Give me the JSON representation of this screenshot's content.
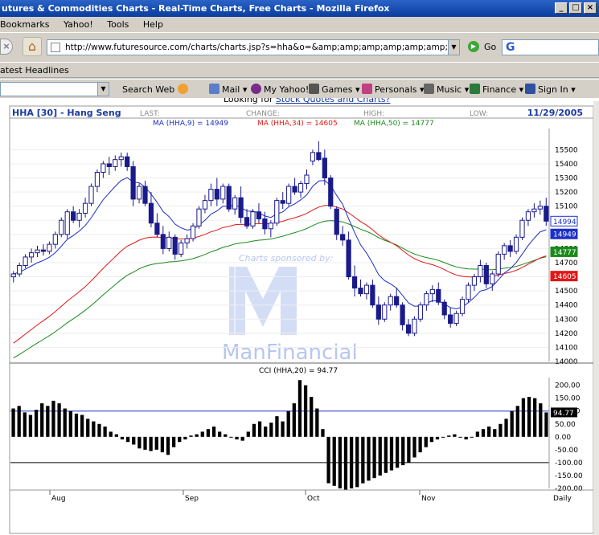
{
  "window": {
    "title": "utures & Commodities Charts - Real-Time Charts, Free Charts - Mozilla Firefox",
    "buttons": [
      "_",
      "□",
      "×"
    ]
  },
  "menu": [
    "Bookmarks",
    "Yahoo!",
    "Tools",
    "Help"
  ],
  "nav": {
    "url": "http://www.futuresource.com/charts/charts.jsp?s=hha&o=&amp;amp;amp;amp;amp;amp;amp;amp;amp;a=D",
    "go_label": "Go"
  },
  "bookmarks": {
    "headlines": "atest Headlines"
  },
  "yahoo_toolbar": {
    "items": [
      {
        "label": "Search Web",
        "icon": "search-dropdown-icon"
      },
      {
        "label": "Mail",
        "icon": "mail-icon"
      },
      {
        "label": "My Yahoo!",
        "icon": "my-yahoo-icon"
      },
      {
        "label": "Games",
        "icon": "games-icon"
      },
      {
        "label": "Personals",
        "icon": "personals-icon"
      },
      {
        "label": "Music",
        "icon": "music-icon"
      },
      {
        "label": "Finance",
        "icon": "finance-icon"
      },
      {
        "label": "Sign In",
        "icon": "sign-in-icon"
      }
    ]
  },
  "page": {
    "looking_for": "Looking for ",
    "looking_link": "Stock Quotes and Charts?",
    "symbol": "HHA [30] - Hang Seng",
    "last_label": "LAST:",
    "change_label": "CHANGE:",
    "high_label": "HIGH:",
    "low_label": "LOW:",
    "date": "11/29/2005",
    "sponsor_text": "Charts sponsored by:",
    "sponsor_name": "ManFinancial"
  },
  "colors": {
    "ma9": "#1c2fc9",
    "ma34": "#e01818",
    "ma50": "#1a8a1a",
    "candle": "#1a1a8a",
    "cci_line": "#1c2fc9",
    "header": "#1a3aa0",
    "date": "#1a3aa0",
    "sponsor": "#b8c6f0"
  },
  "chart_data": [
    {
      "type": "candlestick",
      "title": "HHA [30] - Hang Seng",
      "legend": [
        {
          "label": "MA (HHA,9) = 14949",
          "color": "#1c2fc9"
        },
        {
          "label": "MA (HHA,34) = 14605",
          "color": "#e01818"
        },
        {
          "label": "MA (HHA,50) = 14777",
          "color": "#1a8a1a"
        }
      ],
      "ylim": [
        14000,
        15650
      ],
      "y_ticks": [
        15500,
        15400,
        15300,
        15200,
        15100,
        15000,
        14900,
        14800,
        14700,
        14600,
        14500,
        14400,
        14300,
        14200,
        14100,
        14000
      ],
      "x_ticks": [
        "Aug",
        "Sep",
        "Oct",
        "Nov",
        "Daily"
      ],
      "last_value_tags": [
        {
          "label": "14994",
          "value": 14994,
          "color": "#1c2fc9"
        },
        {
          "label": "14949",
          "value": 14949,
          "color": "#1c2fc9"
        },
        {
          "label": "14777",
          "value": 14777,
          "color": "#1a8a1a"
        },
        {
          "label": "14605",
          "value": 14605,
          "color": "#e01818"
        }
      ],
      "candles": [
        [
          14600,
          14640,
          14560,
          14620
        ],
        [
          14620,
          14700,
          14600,
          14680
        ],
        [
          14680,
          14760,
          14660,
          14740
        ],
        [
          14740,
          14800,
          14700,
          14770
        ],
        [
          14770,
          14820,
          14740,
          14790
        ],
        [
          14790,
          14830,
          14750,
          14780
        ],
        [
          14780,
          14850,
          14760,
          14830
        ],
        [
          14830,
          14920,
          14800,
          14900
        ],
        [
          14900,
          15020,
          14880,
          15000
        ],
        [
          14900,
          15080,
          14870,
          15060
        ],
        [
          15060,
          15100,
          14980,
          15000
        ],
        [
          15000,
          15080,
          14950,
          15050
        ],
        [
          15050,
          15160,
          15020,
          15120
        ],
        [
          15120,
          15260,
          15100,
          15240
        ],
        [
          15240,
          15360,
          15200,
          15340
        ],
        [
          15340,
          15420,
          15300,
          15400
        ],
        [
          15400,
          15450,
          15320,
          15380
        ],
        [
          15380,
          15460,
          15350,
          15430
        ],
        [
          15430,
          15480,
          15380,
          15450
        ],
        [
          15450,
          15480,
          15350,
          15380
        ],
        [
          15380,
          15420,
          15100,
          15150
        ],
        [
          15150,
          15260,
          15120,
          15240
        ],
        [
          15240,
          15280,
          15100,
          15120
        ],
        [
          15120,
          15200,
          14950,
          14980
        ],
        [
          14980,
          15050,
          14880,
          14900
        ],
        [
          14900,
          14960,
          14760,
          14800
        ],
        [
          14800,
          14920,
          14780,
          14880
        ],
        [
          14880,
          14900,
          14720,
          14760
        ],
        [
          14760,
          14860,
          14740,
          14840
        ],
        [
          14840,
          14900,
          14800,
          14870
        ],
        [
          14870,
          14980,
          14850,
          14960
        ],
        [
          14960,
          15100,
          14940,
          15080
        ],
        [
          15080,
          15180,
          15050,
          15140
        ],
        [
          15140,
          15260,
          15100,
          15220
        ],
        [
          15220,
          15300,
          15100,
          15150
        ],
        [
          15150,
          15260,
          15120,
          15240
        ],
        [
          15240,
          15260,
          15060,
          15080
        ],
        [
          15080,
          15180,
          15040,
          15160
        ],
        [
          15160,
          15240,
          14980,
          15020
        ],
        [
          15020,
          15080,
          14940,
          14960
        ],
        [
          14960,
          15080,
          14940,
          15060
        ],
        [
          15060,
          15120,
          14980,
          15010
        ],
        [
          15010,
          15060,
          14900,
          14940
        ],
        [
          14940,
          15000,
          14880,
          14980
        ],
        [
          14980,
          15160,
          14960,
          15140
        ],
        [
          15140,
          15200,
          15080,
          15120
        ],
        [
          15120,
          15260,
          15100,
          15240
        ],
        [
          15240,
          15300,
          15180,
          15200
        ],
        [
          15200,
          15280,
          15160,
          15260
        ],
        [
          15260,
          15360,
          15220,
          15320
        ],
        [
          15420,
          15500,
          15390,
          15480
        ],
        [
          15480,
          15560,
          15420,
          15430
        ],
        [
          15440,
          15500,
          15250,
          15300
        ],
        [
          15300,
          15320,
          15080,
          15100
        ],
        [
          15080,
          15100,
          14860,
          14900
        ],
        [
          14900,
          14960,
          14820,
          14860
        ],
        [
          14860,
          14920,
          14580,
          14600
        ],
        [
          14600,
          14680,
          14460,
          14520
        ],
        [
          14520,
          14580,
          14460,
          14480
        ],
        [
          14480,
          14560,
          14440,
          14540
        ],
        [
          14540,
          14580,
          14380,
          14400
        ],
        [
          14400,
          14460,
          14260,
          14300
        ],
        [
          14300,
          14420,
          14280,
          14400
        ],
        [
          14400,
          14480,
          14360,
          14460
        ],
        [
          14460,
          14520,
          14380,
          14400
        ],
        [
          14400,
          14420,
          14220,
          14260
        ],
        [
          14260,
          14300,
          14180,
          14200
        ],
        [
          14200,
          14320,
          14180,
          14300
        ],
        [
          14300,
          14420,
          14280,
          14400
        ],
        [
          14400,
          14500,
          14360,
          14480
        ],
        [
          14480,
          14540,
          14420,
          14510
        ],
        [
          14510,
          14560,
          14400,
          14420
        ],
        [
          14420,
          14440,
          14300,
          14330
        ],
        [
          14330,
          14380,
          14240,
          14270
        ],
        [
          14270,
          14360,
          14250,
          14340
        ],
        [
          14340,
          14460,
          14320,
          14440
        ],
        [
          14440,
          14560,
          14420,
          14540
        ],
        [
          14540,
          14620,
          14500,
          14600
        ],
        [
          14600,
          14720,
          14560,
          14680
        ],
        [
          14680,
          14700,
          14520,
          14550
        ],
        [
          14550,
          14640,
          14500,
          14620
        ],
        [
          14620,
          14780,
          14600,
          14760
        ],
        [
          14760,
          14840,
          14720,
          14820
        ],
        [
          14820,
          14860,
          14740,
          14780
        ],
        [
          14780,
          14900,
          14760,
          14880
        ],
        [
          14880,
          15020,
          14860,
          15000
        ],
        [
          15000,
          15080,
          14960,
          15060
        ],
        [
          15060,
          15120,
          15020,
          15080
        ],
        [
          15080,
          15140,
          15040,
          15100
        ],
        [
          15100,
          15160,
          14960,
          14994
        ]
      ]
    },
    {
      "type": "bar",
      "title": "CCI (HHA,20) = 94.77",
      "ylim": [
        -200,
        230
      ],
      "y_ticks": [
        "200.00",
        "150.00",
        "100.00",
        "50.00",
        "0.00",
        "-50.00",
        "-100.00",
        "-150.00",
        "-200.00"
      ],
      "y_tick_values": [
        200,
        150,
        100,
        50,
        0,
        -50,
        -100,
        -150,
        -200
      ],
      "reference_lines": [
        100,
        -100
      ],
      "last_value_tag": "94.77",
      "last_value": 94.77,
      "values": [
        110,
        120,
        95,
        85,
        105,
        130,
        120,
        140,
        130,
        110,
        100,
        90,
        85,
        70,
        60,
        50,
        40,
        20,
        10,
        -10,
        -20,
        -30,
        -45,
        -50,
        -55,
        -50,
        -60,
        -70,
        -40,
        -20,
        -10,
        5,
        10,
        20,
        30,
        40,
        20,
        10,
        0,
        -10,
        -15,
        20,
        50,
        60,
        40,
        55,
        80,
        60,
        100,
        130,
        220,
        200,
        155,
        110,
        30,
        -180,
        -190,
        -200,
        -205,
        -200,
        -195,
        -180,
        -170,
        -160,
        -150,
        -140,
        -130,
        -120,
        -110,
        -100,
        -80,
        -60,
        -40,
        -20,
        -10,
        0,
        5,
        10,
        0,
        -10,
        0,
        20,
        30,
        40,
        30,
        50,
        70,
        100,
        120,
        150,
        155,
        150,
        130,
        94.77
      ]
    }
  ]
}
